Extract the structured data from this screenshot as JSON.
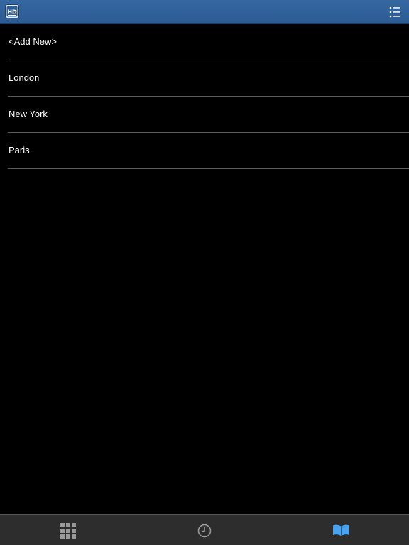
{
  "header": {
    "logo_icon": "hd-app-logo-icon",
    "menu_icon": "list-menu-icon",
    "bar_color": "#2f5f98"
  },
  "list": {
    "items": [
      {
        "label": "<Add New>"
      },
      {
        "label": "London"
      },
      {
        "label": "New York"
      },
      {
        "label": "Paris"
      }
    ]
  },
  "tabbar": {
    "tabs": [
      {
        "icon": "grid-icon",
        "selected": false
      },
      {
        "icon": "clock-icon",
        "selected": false
      },
      {
        "icon": "book-icon",
        "selected": true
      }
    ],
    "active_color": "#4aa3f0",
    "inactive_color": "#9a9a9a"
  }
}
